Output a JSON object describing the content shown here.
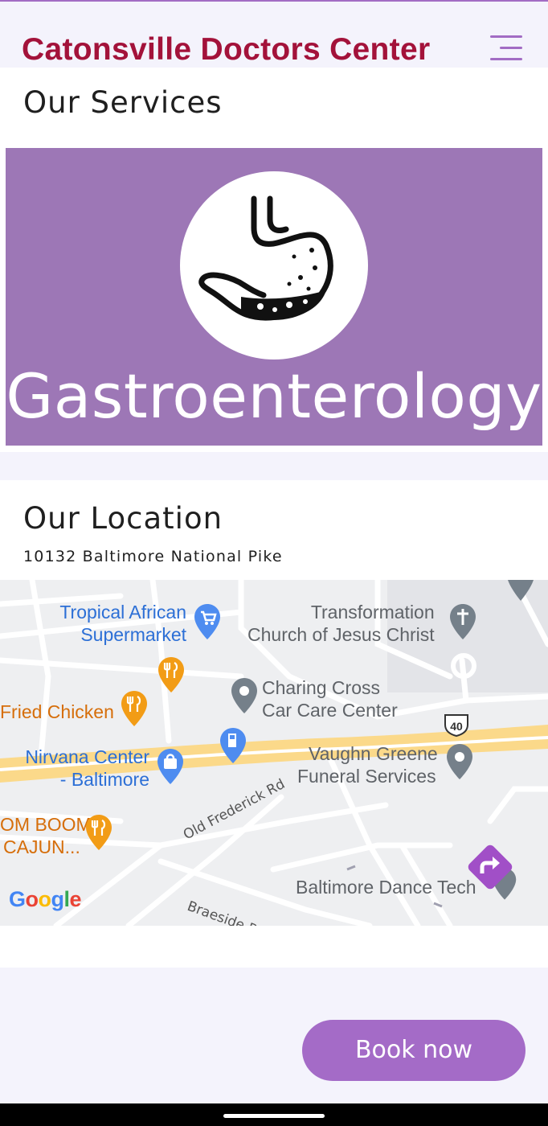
{
  "header": {
    "title": "Catonsville Doctors Center",
    "menu_icon": "hamburger-menu-icon",
    "accent_color": "#a3123a"
  },
  "services": {
    "heading": "Our Services",
    "banner_text": "Gastroenterology",
    "banner_icon": "stomach-icon",
    "banner_color": "#9d77b6"
  },
  "location": {
    "heading": "Our Location",
    "address": "10132 Baltimore National Pike",
    "map": {
      "pois": [
        {
          "name": "Tropical African Supermarket",
          "line1": "Tropical African",
          "line2": "Supermarket",
          "icon": "shopping-cart-icon"
        },
        {
          "name": "Transformation Church of Jesus Christ",
          "line1": "Transformation",
          "line2": "Church of Jesus Christ",
          "icon": "church-icon"
        },
        {
          "name": "Charing Cross Car Care Center",
          "line1": "Charing Cross",
          "line2": "Car Care Center",
          "icon": "place-icon"
        },
        {
          "name": "Fried Chicken",
          "line1": "Fried Chicken",
          "icon": "restaurant-icon"
        },
        {
          "name": "Nirvana Center - Baltimore",
          "line1": "Nirvana Center",
          "line2": "- Baltimore",
          "icon": "shopping-bag-icon"
        },
        {
          "name": "Vaughn Greene Funeral Services",
          "line1": "Vaughn Greene",
          "line2": "Funeral Services",
          "icon": "place-icon"
        },
        {
          "name": "BOOM BOOM CAJUN",
          "line1": "OM BOOM",
          "line2": "CAJUN...",
          "icon": "restaurant-icon"
        },
        {
          "name": "Baltimore Dance Tech",
          "line1": "Baltimore Dance Tech",
          "icon": "place-icon"
        }
      ],
      "roads": [
        "Old Frederick Rd",
        "Braeside Rd"
      ],
      "route_shield": "40",
      "attribution": "Google",
      "directions_icon": "directions-icon"
    }
  },
  "book_button": {
    "label": "Book now",
    "color": "#a46bc7"
  }
}
